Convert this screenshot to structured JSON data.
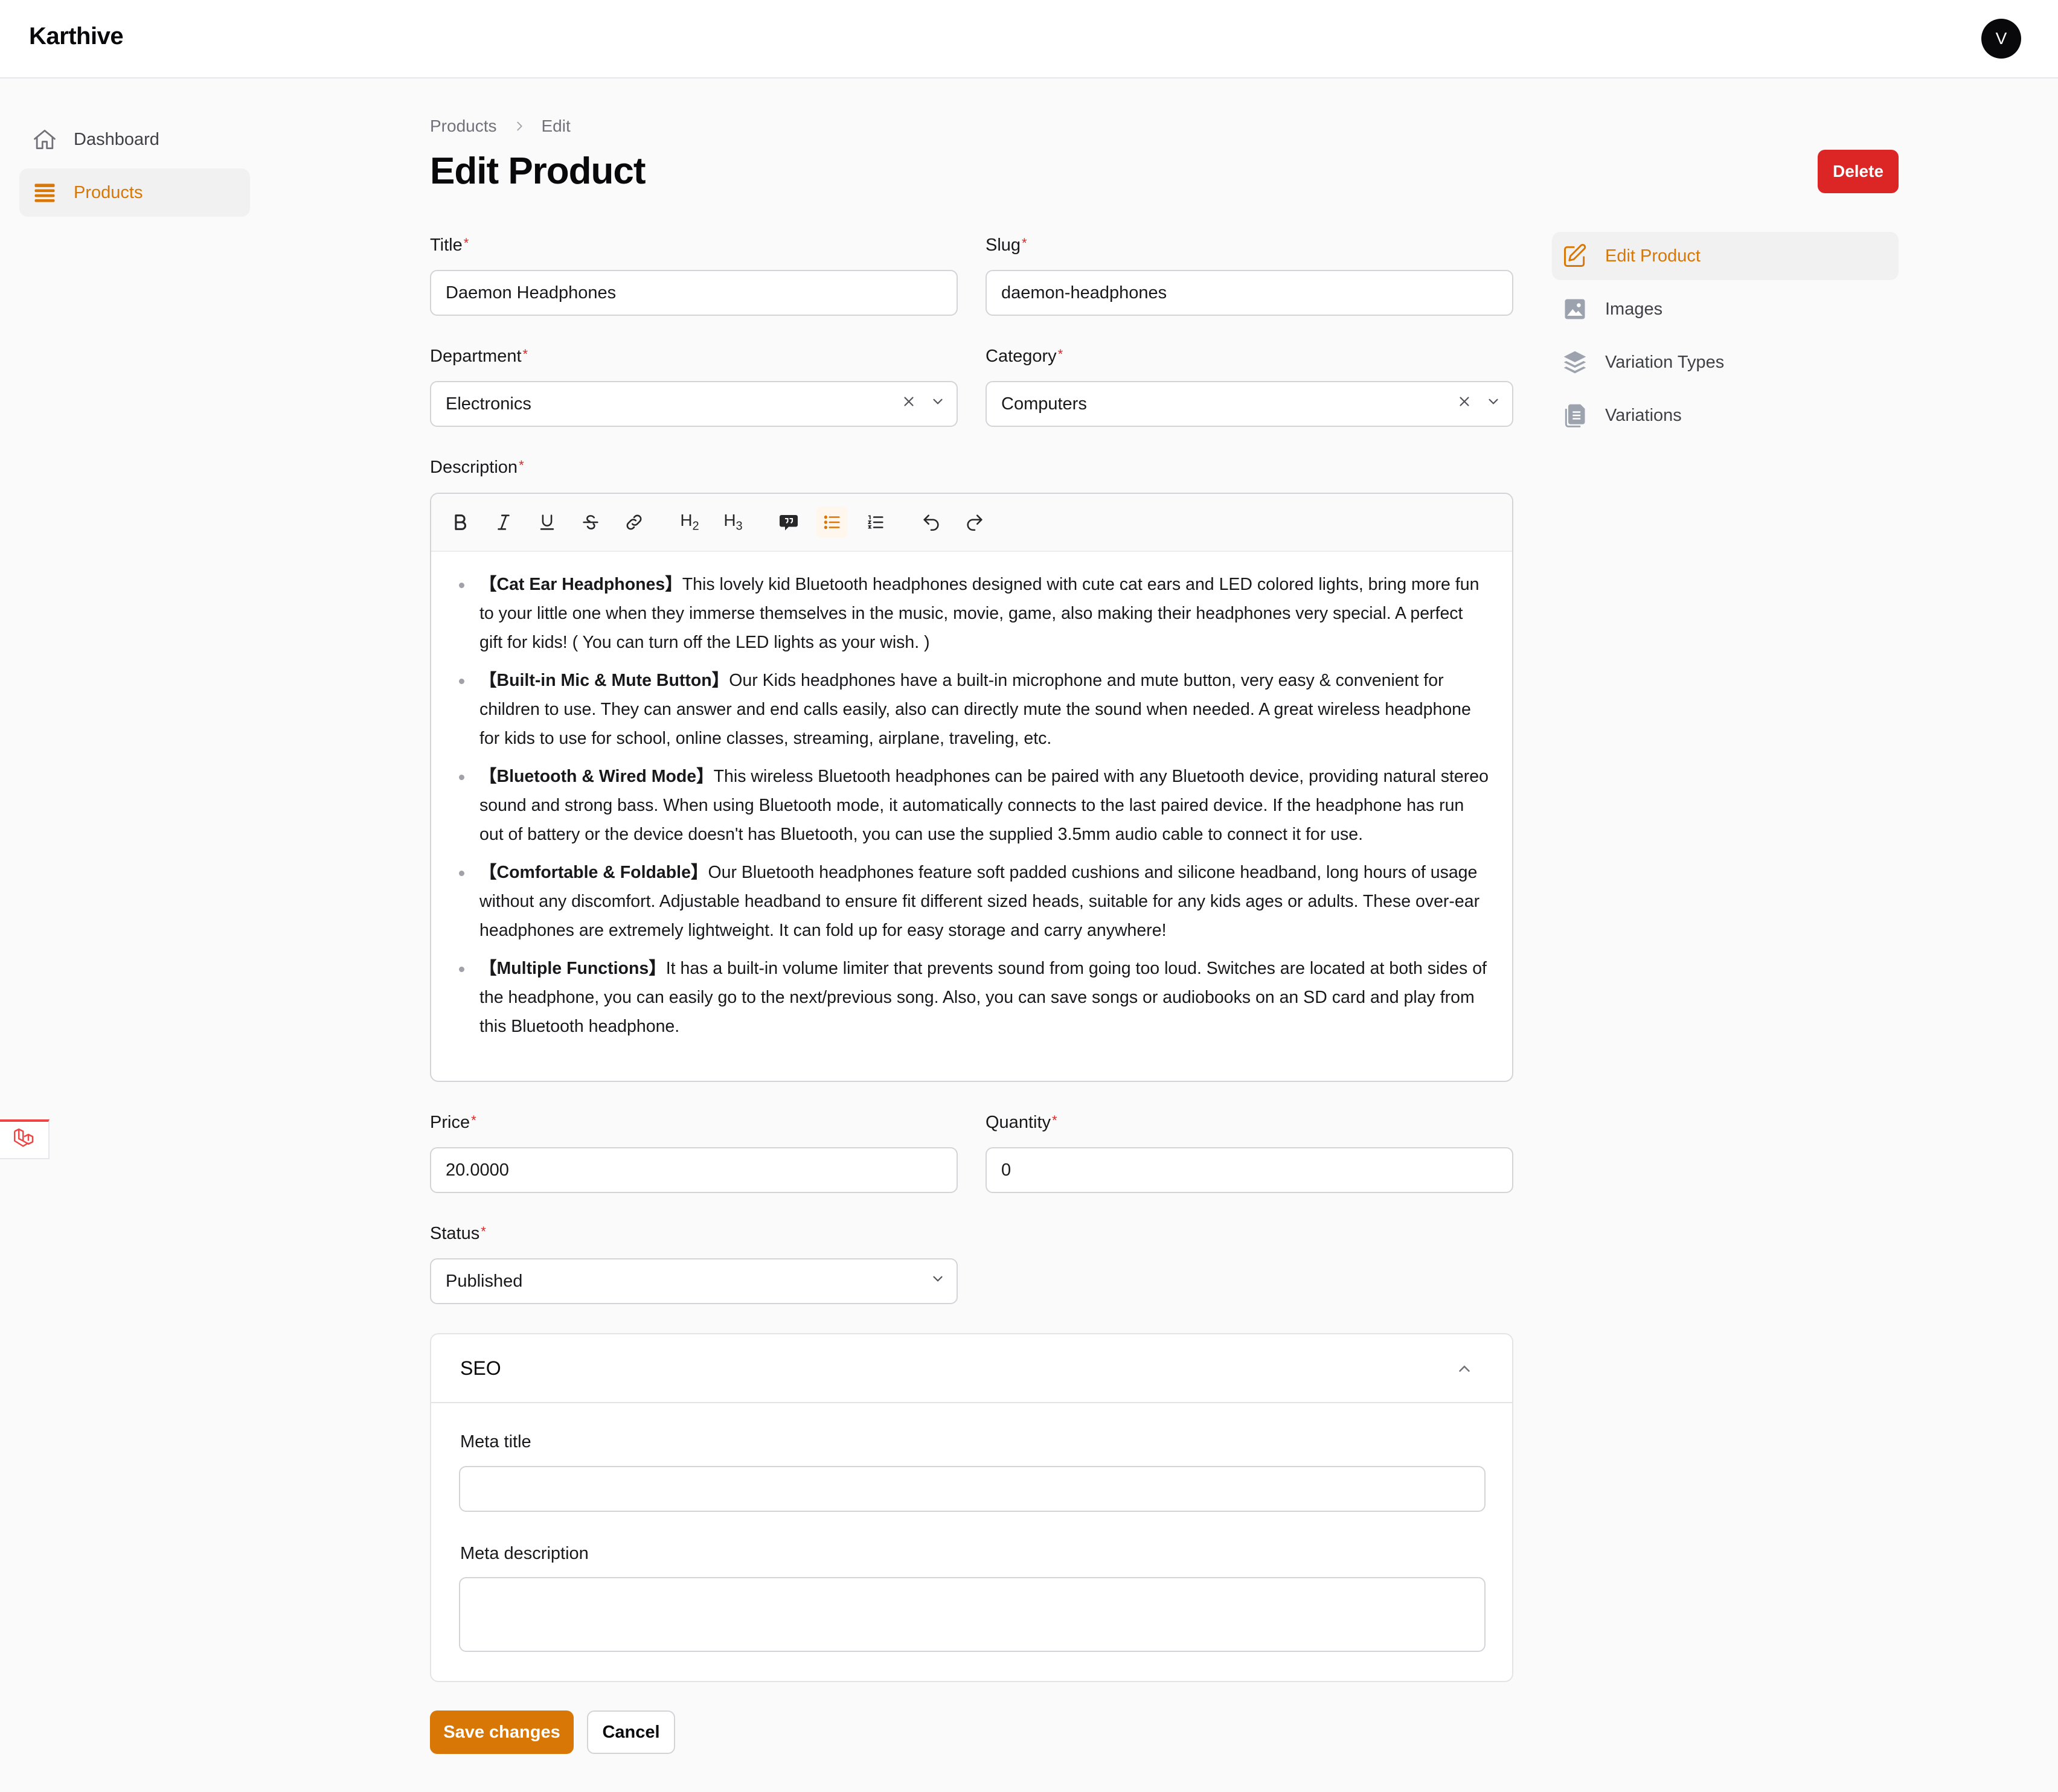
{
  "app": {
    "brand": "Karthive",
    "user_initial": "V"
  },
  "sidebar": {
    "items": [
      {
        "label": "Dashboard",
        "icon": "home-icon",
        "active": false
      },
      {
        "label": "Products",
        "icon": "stack-icon",
        "active": true
      }
    ]
  },
  "breadcrumb": {
    "parent": "Products",
    "current": "Edit"
  },
  "page": {
    "title": "Edit Product",
    "delete_label": "Delete"
  },
  "form": {
    "title": {
      "label": "Title",
      "value": "Daemon Headphones"
    },
    "slug": {
      "label": "Slug",
      "value": "daemon-headphones"
    },
    "department": {
      "label": "Department",
      "value": "Electronics"
    },
    "category": {
      "label": "Category",
      "value": "Computers"
    },
    "description": {
      "label": "Description",
      "items": [
        {
          "bold": "【Cat Ear Headphones】",
          "text": "This lovely kid Bluetooth headphones designed with cute cat ears and LED colored lights, bring more fun to your little one when they immerse themselves in the music, movie, game, also making their headphones very special. A perfect gift for kids! ( You can turn off the LED lights as your wish. )"
        },
        {
          "bold": "【Built-in Mic & Mute Button】",
          "text": "Our Kids headphones have a built-in microphone and mute button, very easy & convenient for children to use. They can answer and end calls easily, also can directly mute the sound when needed. A great wireless headphone for kids to use for school, online classes, streaming, airplane, traveling, etc."
        },
        {
          "bold": "【Bluetooth & Wired Mode】",
          "text": "This wireless Bluetooth headphones can be paired with any Bluetooth device, providing natural stereo sound and strong bass. When using Bluetooth mode, it automatically connects to the last paired device. If the headphone has run out of battery or the device doesn't has Bluetooth, you can use the supplied 3.5mm audio cable to connect it for use."
        },
        {
          "bold": "【Comfortable & Foldable】",
          "text": "Our Bluetooth headphones feature soft padded cushions and silicone headband, long hours of usage without any discomfort. Adjustable headband to ensure fit different sized heads, suitable for any kids ages or adults. These over-ear headphones are extremely lightweight. It can fold up for easy storage and carry anywhere!"
        },
        {
          "bold": "【Multiple Functions】",
          "text": "It has a built-in volume limiter that prevents sound from going too loud. Switches are located at both sides of the headphone, you can easily go to the next/previous song. Also, you can save songs or audiobooks on an SD card and play from this Bluetooth headphone."
        }
      ]
    },
    "price": {
      "label": "Price",
      "value": "20.0000"
    },
    "quantity": {
      "label": "Quantity",
      "value": "0"
    },
    "status": {
      "label": "Status",
      "value": "Published"
    },
    "seo": {
      "title": "SEO",
      "meta_title_label": "Meta title",
      "meta_title_value": "",
      "meta_description_label": "Meta description",
      "meta_description_value": ""
    },
    "save_label": "Save changes",
    "cancel_label": "Cancel",
    "required_mark": "*"
  },
  "toolbar": {
    "icons": [
      "bold-icon",
      "italic-icon",
      "underline-icon",
      "strikethrough-icon",
      "link-icon",
      "heading2-icon",
      "heading3-icon",
      "blockquote-icon",
      "bullet-list-icon",
      "ordered-list-icon",
      "undo-icon",
      "redo-icon"
    ],
    "h2": "H",
    "h3": "H",
    "h2_sub": "2",
    "h3_sub": "3"
  },
  "subnav": {
    "items": [
      {
        "label": "Edit Product",
        "icon": "pencil-square-icon",
        "active": true
      },
      {
        "label": "Images",
        "icon": "photo-icon",
        "active": false
      },
      {
        "label": "Variation Types",
        "icon": "layers-icon",
        "active": false
      },
      {
        "label": "Variations",
        "icon": "documents-icon",
        "active": false
      }
    ]
  },
  "colors": {
    "accent": "#d97706",
    "danger": "#dc2626",
    "border": "#d4d4d8",
    "background": "#fafafa"
  }
}
